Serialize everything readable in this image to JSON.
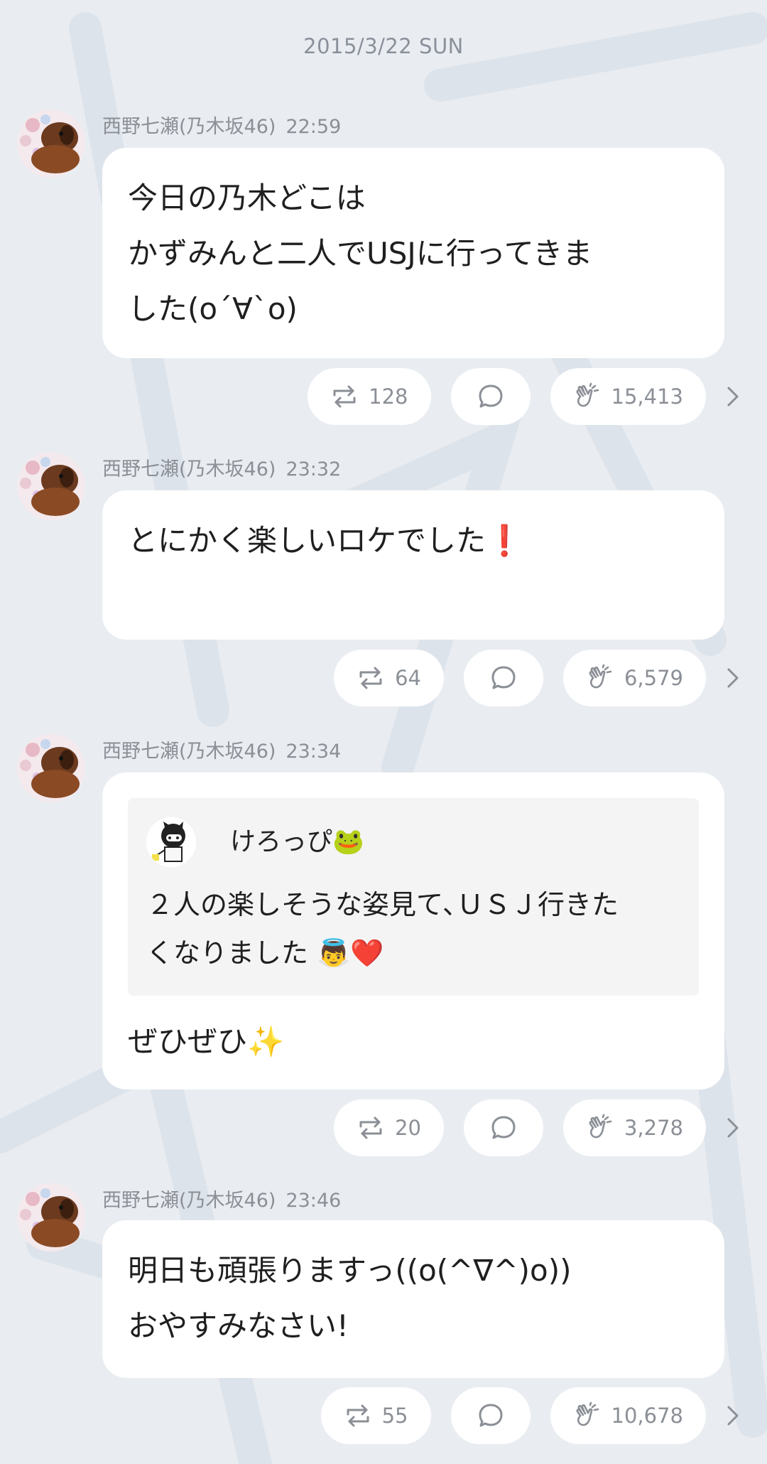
{
  "date_header": "2015/3/22 SUN",
  "posts": [
    {
      "author": "西野七瀬(乃木坂46)",
      "time": "22:59",
      "lines": [
        "今日の乃木どこは",
        "かずみんと二人でUSJに行ってきま",
        "した(o´∀`o)"
      ],
      "reposts": "128",
      "claps": "15,413"
    },
    {
      "author": "西野七瀬(乃木坂46)",
      "time": "23:32",
      "lines": [
        "とにかく楽しいロケでした❗️"
      ],
      "reposts": "64",
      "claps": "6,579"
    },
    {
      "author": "西野七瀬(乃木坂46)",
      "time": "23:34",
      "quote": {
        "name": "けろっぴ🐸",
        "lines": [
          "２人の楽しそうな姿見て､ＵＳＪ行きた",
          "くなりました 👼❤️"
        ]
      },
      "lines": [
        "ぜひぜひ✨"
      ],
      "reposts": "20",
      "claps": "3,278"
    },
    {
      "author": "西野七瀬(乃木坂46)",
      "time": "23:46",
      "lines": [
        "明日も頑張りますっ((o(^∇^)o))",
        "おやすみなさい!"
      ],
      "reposts": "55",
      "claps": "10,678"
    }
  ],
  "icons": {
    "repost": "repost-icon",
    "comment": "comment-icon",
    "clap": "clap-icon",
    "chevron": "chevron-right-icon"
  },
  "colors": {
    "background": "#e9edf2",
    "bubble": "#ffffff",
    "meta_text": "#8b8f96"
  }
}
